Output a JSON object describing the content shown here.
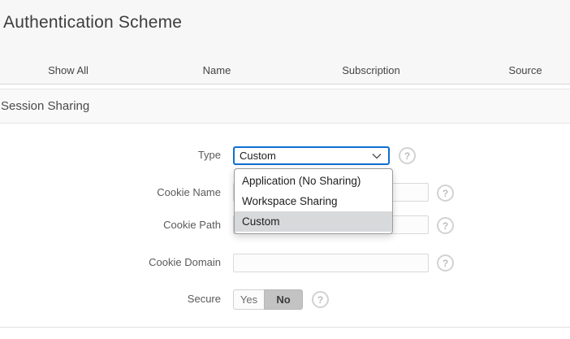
{
  "header": {
    "title": "Authentication Scheme"
  },
  "tabs": {
    "items": [
      {
        "label": "Show All"
      },
      {
        "label": "Name"
      },
      {
        "label": "Subscription"
      },
      {
        "label": "Source"
      }
    ]
  },
  "section": {
    "title": "Session Sharing"
  },
  "form": {
    "type": {
      "label": "Type",
      "value": "Custom"
    },
    "type_dropdown": {
      "options": [
        {
          "label": "Application (No Sharing)",
          "highlighted": false
        },
        {
          "label": "Workspace Sharing",
          "highlighted": false
        },
        {
          "label": "Custom",
          "highlighted": true
        }
      ]
    },
    "cookie_name": {
      "label": "Cookie Name",
      "value": ""
    },
    "cookie_path": {
      "label": "Cookie Path",
      "value": ""
    },
    "cookie_domain": {
      "label": "Cookie Domain",
      "value": ""
    },
    "secure": {
      "label": "Secure",
      "yes_label": "Yes",
      "no_label": "No",
      "selected": "No"
    },
    "help_glyph": "?"
  },
  "colors": {
    "focus_border": "#0f6fd0",
    "option_highlight": "#d8d9db",
    "toggle_selected_bg": "#c3c3c3",
    "band_bg": "#f7f7f8"
  }
}
